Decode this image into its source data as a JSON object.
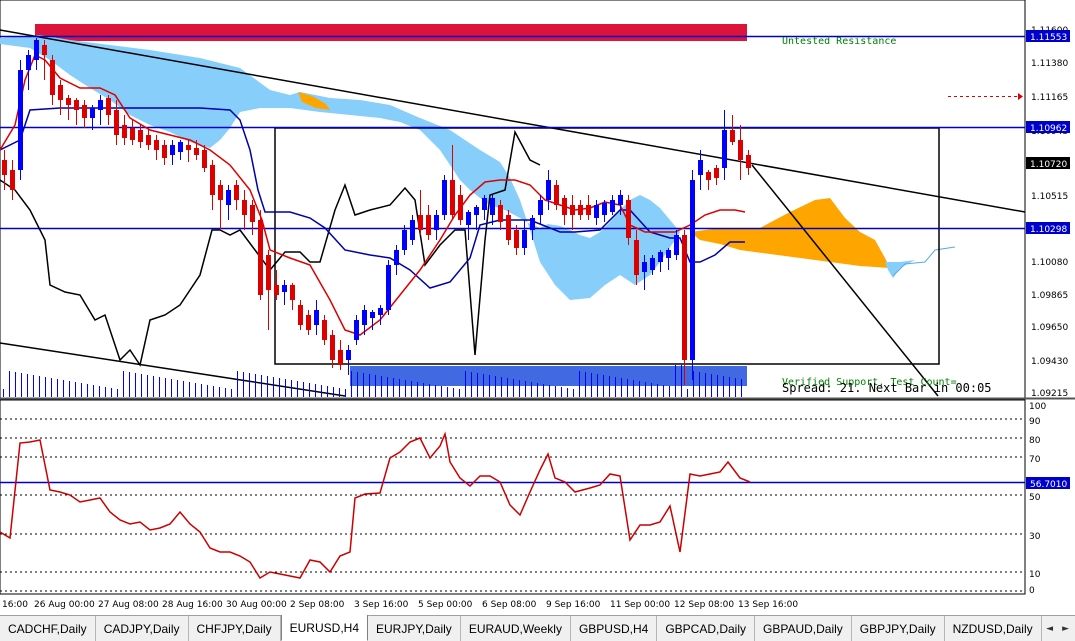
{
  "colors": {
    "bull": "#0000ff",
    "bear": "#dd0000",
    "cloud_bull": "#87cefa",
    "cloud_bear": "#ffa500",
    "level_line": "#0000cc",
    "zone_red": "#dc143c",
    "zone_blue": "#4169e1",
    "rsi": "#cc0000",
    "label_green": "#008000"
  },
  "main": {
    "price_axis": [
      "1.11600",
      "1.11380",
      "1.11165",
      "1.10945",
      "1.10515",
      "1.10080",
      "1.09865",
      "1.09650",
      "1.09430",
      "1.09215"
    ],
    "price_markers": [
      {
        "value": "1.11553",
        "kind": "level"
      },
      {
        "value": "1.10962",
        "kind": "level"
      },
      {
        "value": "1.10720",
        "kind": "current"
      },
      {
        "value": "1.10298",
        "kind": "level"
      }
    ],
    "labels": {
      "untested": "Untested Resistance",
      "verified": "Verified Support, Test Count=",
      "spread": "Spread: 21. Next Bar in 00:05"
    }
  },
  "rsi": {
    "axis": [
      "100",
      "90",
      "80",
      "70",
      "50",
      "30",
      "10",
      "0"
    ],
    "value_label": "56.7010",
    "level": 56.701
  },
  "time_axis": [
    "16:00",
    "26 Aug 00:00",
    "27 Aug 08:00",
    "28 Aug 16:00",
    "30 Aug 00:00",
    "2 Sep 08:00",
    "3 Sep 16:00",
    "5 Sep 00:00",
    "6 Sep 08:00",
    "9 Sep 16:00",
    "11 Sep 00:00",
    "12 Sep 08:00",
    "13 Sep 16:00"
  ],
  "tabs": [
    {
      "label": "CADCHF,Daily",
      "active": false
    },
    {
      "label": "CADJPY,Daily",
      "active": false
    },
    {
      "label": "CHFJPY,Daily",
      "active": false
    },
    {
      "label": "EURUSD,H4",
      "active": true
    },
    {
      "label": "EURJPY,Daily",
      "active": false
    },
    {
      "label": "EURAUD,Weekly",
      "active": false
    },
    {
      "label": "GBPUSD,H4",
      "active": false
    },
    {
      "label": "GBPCAD,Daily",
      "active": false
    },
    {
      "label": "GBPAUD,Daily",
      "active": false
    },
    {
      "label": "GBPJPY,Daily",
      "active": false
    },
    {
      "label": "NZDUSD,Daily",
      "active": false
    }
  ],
  "nav": {
    "prev": "◄",
    "next": "►"
  }
}
